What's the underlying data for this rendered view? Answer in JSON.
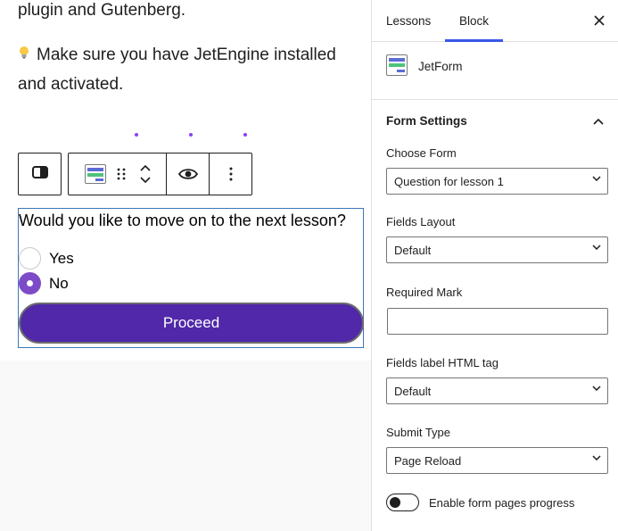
{
  "editor": {
    "paragraph1": "plugin and Gutenberg.",
    "paragraph2_icon": "lightbulb-icon",
    "paragraph2_text": "Make sure you have JetEngine installed and activated.",
    "toolbar": {
      "transform_icon": "block-transform-icon",
      "block_icon": "jetform-block-icon",
      "drag_icon": "drag-handle-icon",
      "move_up_icon": "chevron-up-icon",
      "move_down_icon": "chevron-down-icon",
      "preview_icon": "eye-icon",
      "more_icon": "more-vertical-icon"
    },
    "form": {
      "question": "Would you like to move on to the next lesson?",
      "options": [
        {
          "label": "Yes",
          "checked": false
        },
        {
          "label": "No",
          "checked": true
        }
      ],
      "submit_label": "Proceed",
      "accent_color": "#5128a9",
      "radio_checked_color": "#7e4bc8"
    }
  },
  "sidebar": {
    "tabs": [
      {
        "label": "Lessons",
        "active": false
      },
      {
        "label": "Block",
        "active": true
      }
    ],
    "close_icon": "close-icon",
    "block": {
      "name": "JetForm",
      "icon": "jetform-block-icon"
    },
    "panel": {
      "title": "Form Settings",
      "expanded": true,
      "fields": {
        "choose_form": {
          "label": "Choose Form",
          "value": "Question for lesson 1"
        },
        "fields_layout": {
          "label": "Fields Layout",
          "value": "Default"
        },
        "required_mark": {
          "label": "Required Mark",
          "value": ""
        },
        "label_tag": {
          "label": "Fields label HTML tag",
          "value": "Default"
        },
        "submit_type": {
          "label": "Submit Type",
          "value": "Page Reload"
        }
      },
      "toggle": {
        "label": "Enable form pages progress",
        "on": false
      }
    },
    "accent_color": "#3858e9"
  }
}
